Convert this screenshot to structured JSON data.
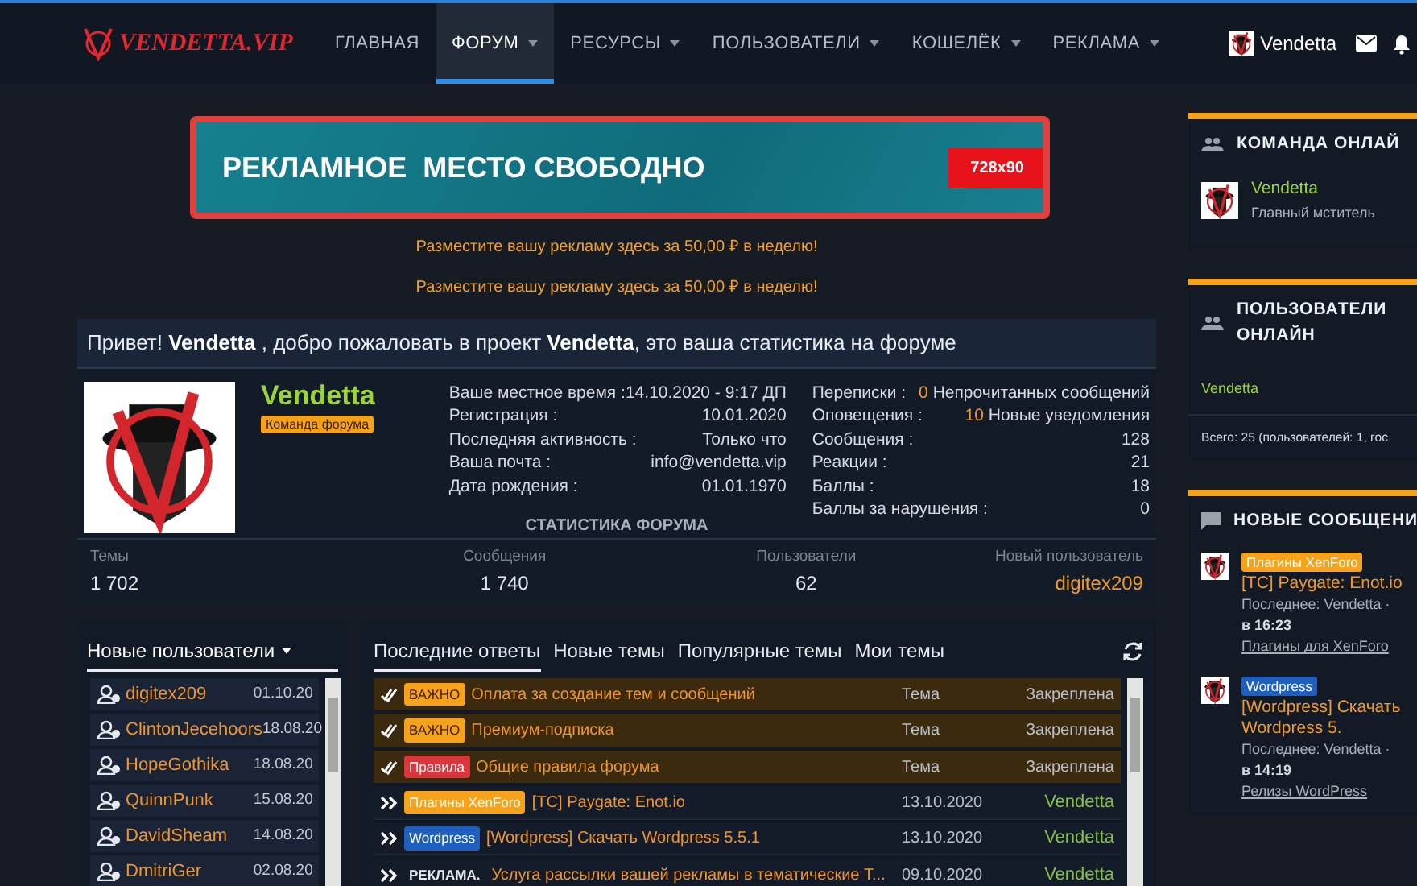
{
  "header": {
    "logo": "VENDETTA.VIP",
    "nav": [
      {
        "label": "ГЛАВНАЯ",
        "selected": false,
        "dropdown": false
      },
      {
        "label": "ФОРУМ",
        "selected": true,
        "dropdown": true
      },
      {
        "label": "РЕСУРСЫ",
        "selected": false,
        "dropdown": true
      },
      {
        "label": "ПОЛЬЗОВАТЕЛИ",
        "selected": false,
        "dropdown": true
      },
      {
        "label": "КОШЕЛЁК",
        "selected": false,
        "dropdown": true
      },
      {
        "label": "РЕКЛАМА",
        "selected": false,
        "dropdown": true
      }
    ],
    "user": {
      "name": "Vendetta"
    }
  },
  "ad_banner": {
    "title": "РЕКЛАМНОЕ  МЕСТО СВОБОДНО",
    "size": "728x90"
  },
  "promos": [
    "Разместите вашу рекламу здесь за 50,00 ₽ в неделю!",
    "Разместите вашу рекламу здесь за 50,00 ₽ в неделю!"
  ],
  "welcome": {
    "greeting": "Привет! **Vendetta** , добро пожаловать в проект **Vendetta**, это ваша статистика на форуме",
    "profile": {
      "name": "Vendetta",
      "role": "Команда форума"
    },
    "details_left": [
      {
        "label": "Ваше местное время :",
        "value": "14.10.2020 - 9:17 ДП"
      },
      {
        "label": "Регистрация :",
        "value": "10.01.2020"
      },
      {
        "label": "Последняя активность :",
        "value": "Только что"
      },
      {
        "label": "Ваша почта :",
        "value": "info@vendetta.vip"
      },
      {
        "label": "Дата рождения :",
        "value": "01.01.1970"
      }
    ],
    "details_right": [
      {
        "label": "Переписки :",
        "count": "0",
        "value": "Непрочитанных сообщений"
      },
      {
        "label": "Оповещения :",
        "count": "10",
        "value": "Новые уведомления"
      },
      {
        "label": "Сообщения :",
        "value": "128"
      },
      {
        "label": "Реакции :",
        "value": "21"
      },
      {
        "label": "Баллы :",
        "value": "18"
      },
      {
        "label": "Баллы за нарушения :",
        "value": "0"
      }
    ],
    "stats_title": "СТАТИСТИКА ФОРУМА",
    "stats": [
      {
        "label": "Темы",
        "value": "1 702",
        "highlight": false
      },
      {
        "label": "Сообщения",
        "value": "1 740",
        "highlight": false
      },
      {
        "label": "Пользователи",
        "value": "62",
        "highlight": false
      },
      {
        "label": "Новый пользователь",
        "value": "digitex209",
        "highlight": true
      }
    ]
  },
  "new_users": {
    "title": "Новые пользователи",
    "items": [
      {
        "name": "digitex209",
        "date": "01.10.20"
      },
      {
        "name": "ClintonJecehoors",
        "date": "18.08.20"
      },
      {
        "name": "HopeGothika",
        "date": "18.08.20"
      },
      {
        "name": "QuinnPunk",
        "date": "15.08.20"
      },
      {
        "name": "DavidSheam",
        "date": "14.08.20"
      },
      {
        "name": "DmitriGer",
        "date": "02.08.20"
      }
    ]
  },
  "threads": {
    "tabs": [
      {
        "label": "Последние ответы",
        "selected": true
      },
      {
        "label": "Новые темы",
        "selected": false
      },
      {
        "label": "Популярные темы",
        "selected": false
      },
      {
        "label": "Мои темы",
        "selected": false
      }
    ],
    "rows": [
      {
        "kind": "sticky",
        "prefix": {
          "text": "ВАЖНО",
          "color": "#f7a21b"
        },
        "title": "Оплата за создание тем и сообщений",
        "column_3": "Тема",
        "column_4": "Закреплена"
      },
      {
        "kind": "sticky",
        "prefix": {
          "text": "ВАЖНО",
          "color": "#f7a21b"
        },
        "title": "Премиум-подписка",
        "column_3": "Тема",
        "column_4": "Закреплена"
      },
      {
        "kind": "sticky",
        "prefix": {
          "text": "Правила",
          "color": "#d9363e"
        },
        "title": "Общие правила форума",
        "column_3": "Тема",
        "column_4": "Закреплена"
      },
      {
        "kind": "normal",
        "prefix": {
          "text": "Плагины XenForo",
          "color": "#f7a21b"
        },
        "title": "[TC] Paygate: Enot.io",
        "column_3": "13.10.2020",
        "column_4": "Vendetta"
      },
      {
        "kind": "normal",
        "prefix": {
          "text": "Wordpress",
          "color": "#1f5fbf"
        },
        "title": "[Wordpress] Скачать Wordpress 5.5.1",
        "column_3": "13.10.2020",
        "column_4": "Vendetta"
      },
      {
        "kind": "normal",
        "prefix": {
          "text": "РЕКЛАМА."
        },
        "title": "Услуга рассылки вашей рекламы в тематические Т...",
        "column_3": "09.10.2020",
        "column_4": "Vendetta"
      }
    ]
  },
  "sidebar": {
    "team_online": {
      "title": "КОМАНДА ОНЛАЙ",
      "members": [
        {
          "name": "Vendetta",
          "role": "Главный мститель"
        }
      ]
    },
    "users_online": {
      "title": "ПОЛЬЗОВАТЕЛИ ОНЛАЙН",
      "users": [
        "Vendetta"
      ],
      "total": "Всего: 25 (пользователей: 1, гос"
    },
    "new_posts": {
      "title": "НОВЫЕ СООБЩЕНИ",
      "posts": [
        {
          "prefix": {
            "text": "Плагины XenForo",
            "color": "#f7a21b"
          },
          "title": "[TC] Paygate: Enot.io",
          "meta": "Последнее: Vendetta ·",
          "time": "в 16:23",
          "forum": "Плагины для XenForo"
        },
        {
          "prefix": {
            "text": "Wordpress",
            "color": "#1f5fbf"
          },
          "title": "[Wordpress] Скачать Wordpress 5.",
          "meta": "Последнее: Vendetta ·",
          "time": "в 14:19",
          "forum": "Релизы WordPress"
        }
      ]
    }
  }
}
